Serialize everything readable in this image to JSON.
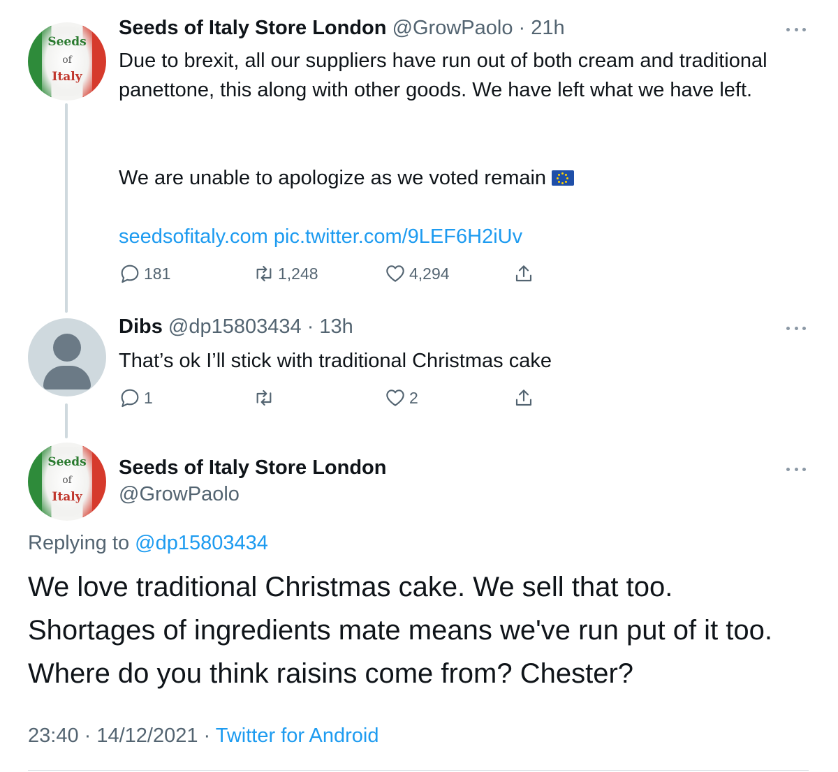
{
  "tweet1": {
    "avatar": {
      "line1": "Seeds",
      "line2": "of",
      "line3": "Italy"
    },
    "name": "Seeds of Italy Store London",
    "handle": "@GrowPaolo",
    "time": "21h",
    "text_para1": "Due to brexit, all our suppliers have run out of both cream and traditional panettone, this along with other goods. We have left what we have left.",
    "text_para2": "We are unable to apologize as we voted remain",
    "flag_icon": "eu-flag-icon",
    "link1": "seedsofitaly.com",
    "link2": "pic.twitter.com/9LEF6H2iUv",
    "reply_count": "181",
    "retweet_count": "1,248",
    "like_count": "4,294"
  },
  "tweet2": {
    "name": "Dibs",
    "handle": "@dp15803434",
    "time": "13h",
    "text": "That’s ok I’ll stick with traditional Christmas cake",
    "reply_count": "1",
    "retweet_count": "",
    "like_count": "2"
  },
  "tweet3": {
    "avatar": {
      "line1": "Seeds",
      "line2": "of",
      "line3": "Italy"
    },
    "name": "Seeds of Italy Store London",
    "handle": "@GrowPaolo",
    "replying_label": "Replying to",
    "replying_handle": "@dp15803434",
    "text_line1": "We love traditional Christmas cake. We sell that too.",
    "text_line2": "Shortages of ingredients mate means we've run put of it too.",
    "text_line3": "Where do you think raisins come from? Chester?",
    "timestamp": "23:40 · 14/12/2021 ·",
    "source": "Twitter for Android"
  },
  "colors": {
    "link": "#1d9bf0",
    "secondary_text": "#536471",
    "thread_line": "#cfd9de"
  }
}
